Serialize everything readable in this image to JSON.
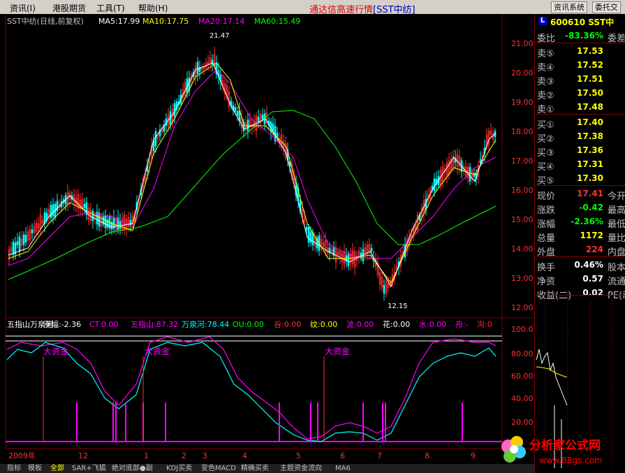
{
  "menu": {
    "items": [
      "资讯(I)",
      "港股期货",
      "工具(T)",
      "帮助(H)"
    ],
    "title": "通达信高速行情",
    "title_sub": "[SST中纺]",
    "buttons": [
      "资讯系统",
      "委托交"
    ]
  },
  "main_chart": {
    "header": {
      "name": "SST中纺(日线,前复权)",
      "ma5": "MA5:17.99",
      "ma10": "MA10:17.75",
      "ma20": "MA20:17.14",
      "ma60": "MA60:15.49"
    },
    "price_ticks": [
      "21.00",
      "20.00",
      "19.00",
      "18.00",
      "17.00",
      "16.00",
      "15.00",
      "14.00",
      "13.00",
      "12.00"
    ],
    "high_marker": "21.47",
    "low_marker": "12.15"
  },
  "indicator": {
    "header": [
      {
        "text": "五指山万泉河",
        "color": "#ffffff"
      },
      {
        "text": "涨幅:-2.36",
        "color": "#ffffff"
      },
      {
        "text": "CT:0.00",
        "color": "#ff00ff"
      },
      {
        "text": "五指山:87.32",
        "color": "#ff00ff"
      },
      {
        "text": "万泉河:78.44",
        "color": "#00ffff"
      },
      {
        "text": "OU:0.00",
        "color": "#00ff00"
      },
      {
        "text": "谷:0.00",
        "color": "#ff3030"
      },
      {
        "text": "纹:0.00",
        "color": "#ffff00"
      },
      {
        "text": "波:0.00",
        "color": "#ff00ff"
      },
      {
        "text": "花:0.00",
        "color": "#ffffff"
      },
      {
        "text": "水:0.00",
        "color": "#ff00ff"
      },
      {
        "text": "舟:-",
        "color": "#ff00ff"
      },
      {
        "text": "沟:0",
        "color": "#ff3030"
      }
    ],
    "ticks": [
      "100.0",
      "80.00",
      "60.00",
      "40.00",
      "20.00"
    ],
    "labels": [
      "大资金",
      "大资金",
      "大资金"
    ]
  },
  "x_axis": {
    "labels": [
      "2009年",
      "12",
      "1",
      "2",
      "3",
      "4",
      "5",
      "6",
      "7",
      "8",
      "9"
    ]
  },
  "tabs": [
    "指标",
    "模板",
    "全部",
    "SAR+飞狐",
    "绝对底部●副",
    "KDJ买卖",
    "变色MACD",
    "精确买卖",
    "主题资金流向",
    "MA6"
  ],
  "quote": {
    "code": "600610 SST中",
    "weibi": {
      "label": "委比",
      "value": "-83.36%",
      "extra": "委差"
    },
    "sell": [
      {
        "label": "卖⑤",
        "value": "17.53"
      },
      {
        "label": "卖④",
        "value": "17.52"
      },
      {
        "label": "卖③",
        "value": "17.51"
      },
      {
        "label": "卖②",
        "value": "17.50"
      },
      {
        "label": "卖①",
        "value": "17.48"
      }
    ],
    "buy": [
      {
        "label": "买①",
        "value": "17.40"
      },
      {
        "label": "买②",
        "value": "17.38"
      },
      {
        "label": "买③",
        "value": "17.36"
      },
      {
        "label": "买④",
        "value": "17.31"
      },
      {
        "label": "买⑤",
        "value": "17.30"
      }
    ],
    "stats": [
      {
        "label": "现价",
        "value": "17.41",
        "extra": "今开",
        "color": "#ff3030"
      },
      {
        "label": "涨跌",
        "value": "-0.42",
        "extra": "最高",
        "color": "#00ff00"
      },
      {
        "label": "涨幅",
        "value": "-2.36%",
        "extra": "最低",
        "color": "#00ff00"
      },
      {
        "label": "总量",
        "value": "1172",
        "extra": "量比",
        "color": "#ffff00"
      },
      {
        "label": "外盘",
        "value": "224",
        "extra": "内盘",
        "color": "#ff3030"
      }
    ],
    "stats2": [
      {
        "label": "换手",
        "value": "0.46%",
        "extra": "股本"
      },
      {
        "label": "净资",
        "value": "0.57",
        "extra": "流通"
      },
      {
        "label": "收益(二)",
        "value": "0.02",
        "extra": "PE(动"
      }
    ]
  },
  "watermark": {
    "logo_text": "分析家公式网",
    "url": "www.88gs.com"
  },
  "colors": {
    "up": "#ff3030",
    "down": "#00ffff",
    "ma5": "#ffffff",
    "ma10": "#ffff00",
    "ma20": "#ff00ff",
    "ma60": "#00ff00",
    "frame": "#800000"
  }
}
